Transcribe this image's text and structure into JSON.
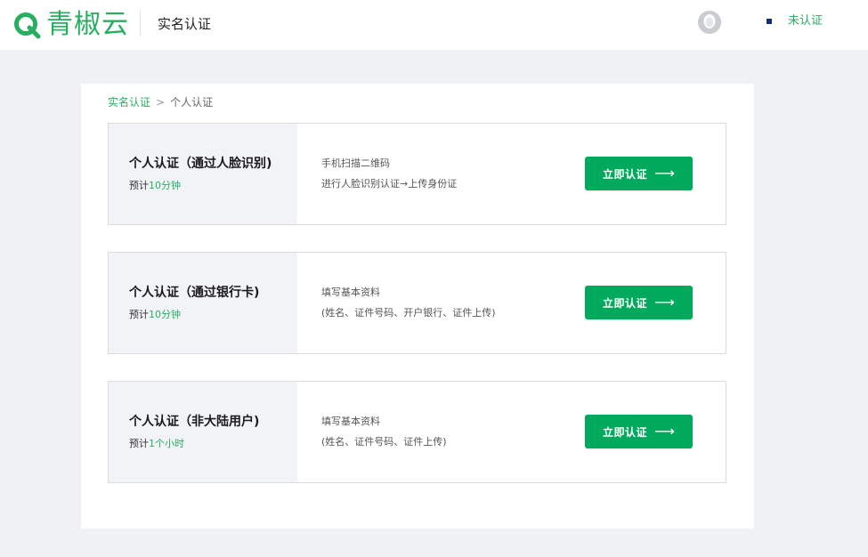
{
  "header": {
    "logo_text": "青椒云",
    "page_name": "实名认证",
    "status": "未认证",
    "brand_color": "#27ae60"
  },
  "breadcrumb": {
    "root": "实名认证",
    "separator": ">",
    "current": "个人认证"
  },
  "cards": [
    {
      "title": "个人认证（通过人脸识别)",
      "est_prefix": "预计",
      "est_value": "10分钟",
      "desc1": "手机扫描二维码",
      "desc2": "进行人脸识别认证→上传身份证",
      "button": "立即认证",
      "button_icon": "arrow-right-icon"
    },
    {
      "title": "个人认证（通过银行卡)",
      "est_prefix": "预计",
      "est_value": "10分钟",
      "desc1": "填写基本资料",
      "desc2": "(姓名、证件号码、开户银行、证件上传)",
      "button": "立即认证",
      "button_icon": "arrow-right-icon"
    },
    {
      "title": "个人认证（非大陆用户)",
      "est_prefix": "预计",
      "est_value": "1个小时",
      "desc1": "填写基本资料",
      "desc2": "(姓名、证件号码、证件上传)",
      "button": "立即认证",
      "button_icon": "arrow-right-icon"
    }
  ]
}
